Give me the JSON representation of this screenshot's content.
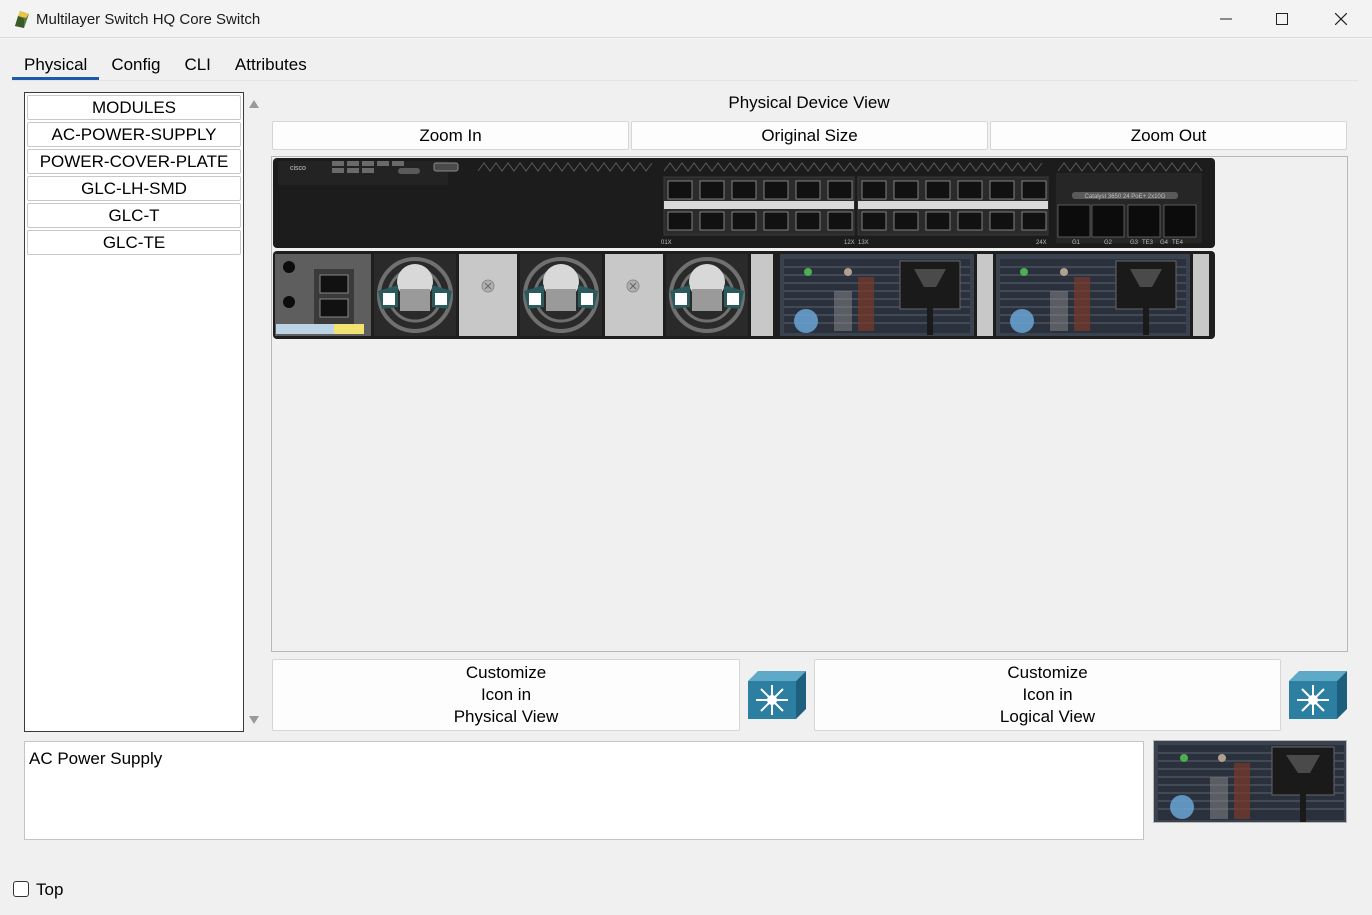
{
  "window": {
    "title": "Multilayer Switch HQ Core Switch",
    "icon": "packet-tracer-app-icon",
    "controls": [
      "minimize-icon",
      "maximize-icon",
      "close-icon"
    ]
  },
  "tabs": [
    {
      "label": "Physical",
      "active": true
    },
    {
      "label": "Config",
      "active": false
    },
    {
      "label": "CLI",
      "active": false
    },
    {
      "label": "Attributes",
      "active": false
    }
  ],
  "modules": [
    "MODULES",
    "AC-POWER-SUPPLY",
    "POWER-COVER-PLATE",
    "GLC-LH-SMD",
    "GLC-T",
    "GLC-TE"
  ],
  "physical_view": {
    "title": "Physical Device View",
    "zoom_in": "Zoom In",
    "original_size": "Original Size",
    "zoom_out": "Zoom Out",
    "device_label": "Catalyst 3650 24 PoE+ 2x10G",
    "front_labels": {
      "brand": "cisco",
      "port_group_1_start": "01X",
      "port_group_1_end": "12X",
      "port_group_2_start": "13X",
      "port_group_2_end": "24X",
      "uplinks": [
        "G1",
        "G2",
        "G3",
        "TE3",
        "G4",
        "TE4"
      ]
    }
  },
  "customize": {
    "physical": [
      "Customize",
      "Icon in",
      "Physical View"
    ],
    "logical": [
      "Customize",
      "Icon in",
      "Logical View"
    ],
    "icon": "multilayer-switch-icon"
  },
  "info": {
    "text": "AC Power Supply",
    "preview_icon": "ac-power-supply-module-icon"
  },
  "footer": {
    "top_label": "Top",
    "top_checked": false
  },
  "colors": {
    "tab_underline": "#1e5aa8",
    "switch_body": "#1c1c1c",
    "switch_icon": "#2d7fa1"
  }
}
